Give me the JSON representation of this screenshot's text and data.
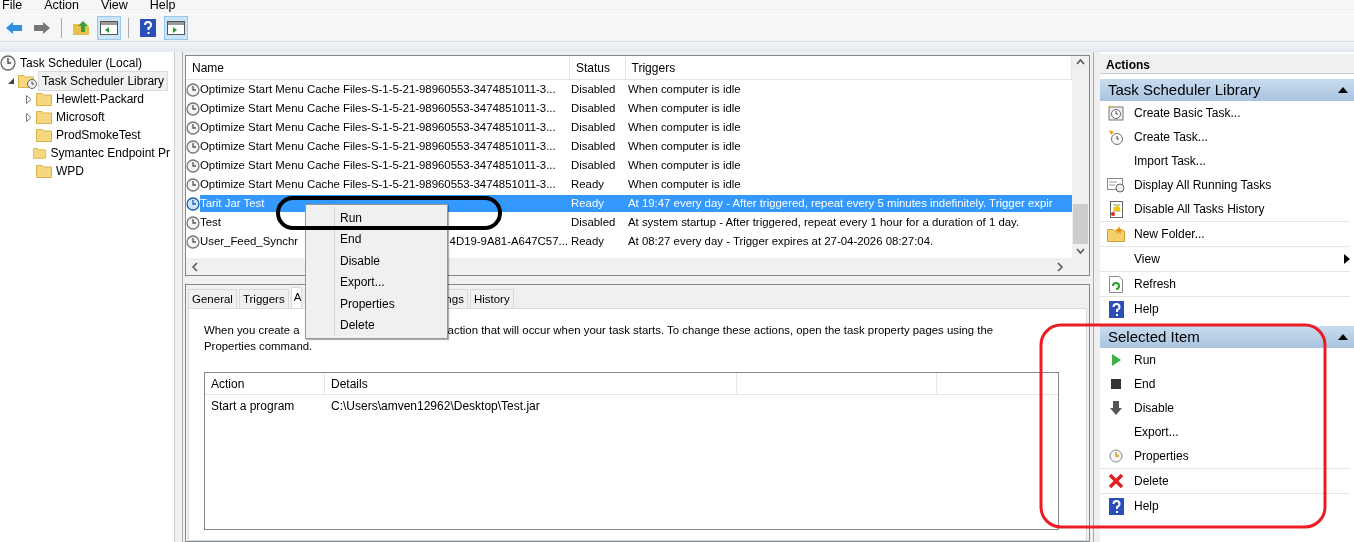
{
  "menu_bar": [
    "File",
    "Action",
    "View",
    "Help"
  ],
  "tree": [
    {
      "label": "Task Scheduler (Local)",
      "selected": false,
      "kind": "root",
      "children": [
        {
          "label": "Task Scheduler Library",
          "selected": true,
          "kind": "branch",
          "expanded": true,
          "children": [
            {
              "label": "Hewlett-Packard",
              "selected": false,
              "kind": "branch",
              "expanded": false
            },
            {
              "label": "Microsoft",
              "selected": false,
              "kind": "branch",
              "expanded": false
            },
            {
              "label": "ProdSmokeTest",
              "selected": false,
              "kind": "leaf"
            },
            {
              "label": "Symantec Endpoint Pr",
              "selected": false,
              "kind": "leaf"
            },
            {
              "label": "WPD",
              "selected": false,
              "kind": "leaf"
            }
          ]
        }
      ]
    }
  ],
  "tasks": {
    "columns": [
      "Name",
      "Status",
      "Triggers"
    ],
    "rows": [
      {
        "name": "Optimize Start Menu Cache Files-S-1-5-21-98960553-3474851011-3...",
        "status": "Disabled",
        "triggers": "When computer is idle",
        "selected": false
      },
      {
        "name": "Optimize Start Menu Cache Files-S-1-5-21-98960553-3474851011-3...",
        "status": "Disabled",
        "triggers": "When computer is idle",
        "selected": false
      },
      {
        "name": "Optimize Start Menu Cache Files-S-1-5-21-98960553-3474851011-3...",
        "status": "Disabled",
        "triggers": "When computer is idle",
        "selected": false
      },
      {
        "name": "Optimize Start Menu Cache Files-S-1-5-21-98960553-3474851011-3...",
        "status": "Disabled",
        "triggers": "When computer is idle",
        "selected": false
      },
      {
        "name": "Optimize Start Menu Cache Files-S-1-5-21-98960553-3474851011-3...",
        "status": "Disabled",
        "triggers": "When computer is idle",
        "selected": false
      },
      {
        "name": "Optimize Start Menu Cache Files-S-1-5-21-98960553-3474851011-3...",
        "status": "Ready",
        "triggers": "When computer is idle",
        "selected": false
      },
      {
        "name": "Tarit Jar Test",
        "status": "Ready",
        "triggers": "At 19:47 every day - After triggered, repeat every 5 minutes indefinitely. Trigger expir",
        "selected": true
      },
      {
        "name": "Test",
        "status": "Disabled",
        "triggers": "At system startup - After triggered, repeat every 1 hour for a duration of 1 day.",
        "selected": false
      },
      {
        "name": "User_Feed_Synchr",
        "name_tail": "4D19-9A81-A647C57...",
        "status": "Ready",
        "triggers": "At 08:27 every day - Trigger expires at 27-04-2026 08:27:04.",
        "selected": false
      }
    ]
  },
  "context_menu": [
    "Run",
    "End",
    "Disable",
    "Export...",
    "Properties",
    "Delete"
  ],
  "tabs": [
    {
      "label": "General",
      "selected": false
    },
    {
      "label": "Triggers",
      "selected": false
    },
    {
      "label": "A",
      "selected": true
    },
    {
      "label": "ngs",
      "selected": false
    },
    {
      "label": "History",
      "selected": false
    }
  ],
  "description": [
    "When you create a",
    "action that will occur when your task starts.  To change these actions, open the task property pages using the",
    "Properties command."
  ],
  "actions_table": {
    "columns": [
      "Action",
      "Details"
    ],
    "rows": [
      [
        "Start a program",
        "C:\\Users\\amven12962\\Desktop\\Test.jar"
      ]
    ]
  },
  "actions_pane": {
    "title": "Actions",
    "sections": [
      {
        "title": "Task Scheduler Library",
        "expanded": true,
        "groups": [
          [
            {
              "label": "Create Basic Task...",
              "submenu": false
            },
            {
              "label": "Create Task...",
              "submenu": false
            },
            {
              "label": "Import Task...",
              "submenu": false
            },
            {
              "label": "Display All Running Tasks",
              "submenu": false
            },
            {
              "label": "Disable All Tasks History",
              "submenu": false
            }
          ],
          [
            {
              "label": "New Folder...",
              "submenu": false
            }
          ],
          [
            {
              "label": "View",
              "submenu": true
            }
          ],
          [
            {
              "label": "Refresh",
              "submenu": false
            }
          ],
          [
            {
              "label": "Help",
              "submenu": false
            }
          ]
        ]
      },
      {
        "title": "Selected Item",
        "expanded": true,
        "groups": [
          [
            {
              "label": "Run",
              "submenu": false
            },
            {
              "label": "End",
              "submenu": false
            },
            {
              "label": "Disable",
              "submenu": false
            },
            {
              "label": "Export...",
              "submenu": false
            },
            {
              "label": "Properties",
              "submenu": false
            }
          ],
          [
            {
              "label": "Delete",
              "submenu": false
            }
          ],
          [
            {
              "label": "Help",
              "submenu": false
            }
          ]
        ]
      }
    ]
  }
}
